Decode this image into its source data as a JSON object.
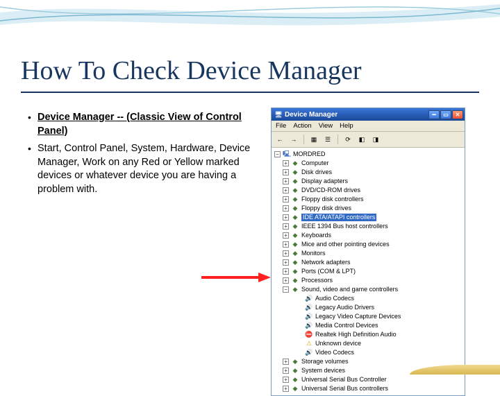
{
  "title": "How To Check Device Manager",
  "bullets": [
    {
      "text": "Device Manager -- (Classic View of Control Panel)",
      "bold": true,
      "underline": true
    },
    {
      "text": "Start, Control Panel, System, Hardware, Device Manager, Work on any Red or Yellow marked devices or whatever device you are having a problem with.",
      "bold": false,
      "underline": false
    }
  ],
  "dm": {
    "title": "Device Manager",
    "menu": [
      "File",
      "Action",
      "View",
      "Help"
    ],
    "root": "MORDRED",
    "selected_label": "IDE ATA/ATAPI controllers",
    "categories": [
      "Computer",
      "Disk drives",
      "Display adapters",
      "DVD/CD-ROM drives",
      "Floppy disk controllers",
      "Floppy disk drives",
      "IDE ATA/ATAPI controllers",
      "IEEE 1394 Bus host controllers",
      "Keyboards",
      "Mice and other pointing devices",
      "Monitors",
      "Network adapters",
      "Ports (COM & LPT)",
      "Processors",
      "Sound, video and game controllers"
    ],
    "sound_children": [
      {
        "label": "Audio Codecs",
        "status": "ok"
      },
      {
        "label": "Legacy Audio Drivers",
        "status": "ok"
      },
      {
        "label": "Legacy Video Capture Devices",
        "status": "ok"
      },
      {
        "label": "Media Control Devices",
        "status": "ok"
      },
      {
        "label": "Realtek High Definition Audio",
        "status": "error"
      },
      {
        "label": "Unknown device",
        "status": "warn"
      },
      {
        "label": "Video Codecs",
        "status": "ok"
      }
    ],
    "tail_categories": [
      "Storage volumes",
      "System devices",
      "Universal Serial Bus Controller",
      "Universal Serial Bus controllers"
    ]
  }
}
